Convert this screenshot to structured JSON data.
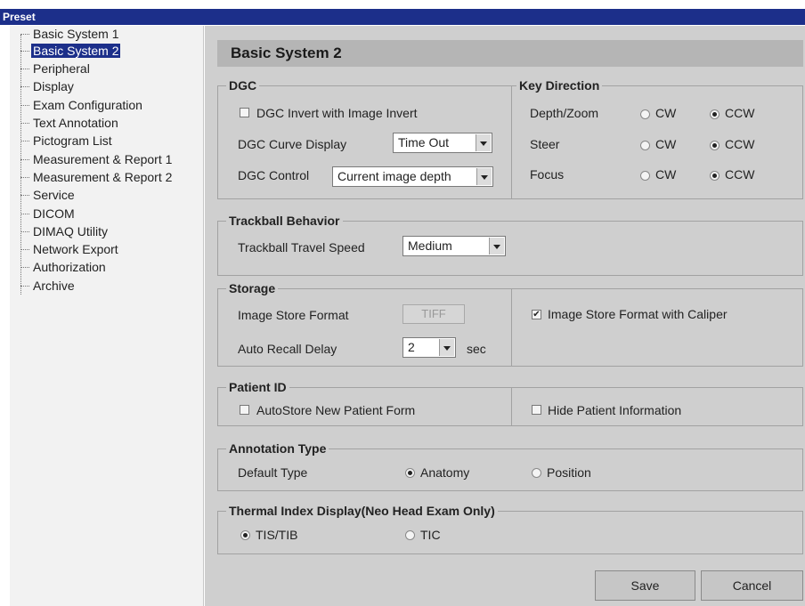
{
  "window": {
    "title": "Preset"
  },
  "sidebar": {
    "items": [
      {
        "label": "Basic System 1"
      },
      {
        "label": "Basic System 2",
        "selected": true
      },
      {
        "label": "Peripheral"
      },
      {
        "label": "Display"
      },
      {
        "label": "Exam Configuration"
      },
      {
        "label": "Text Annotation"
      },
      {
        "label": "Pictogram List"
      },
      {
        "label": "Measurement & Report 1"
      },
      {
        "label": "Measurement & Report 2"
      },
      {
        "label": "Service"
      },
      {
        "label": "DICOM"
      },
      {
        "label": "DIMAQ Utility"
      },
      {
        "label": "Network Export"
      },
      {
        "label": "Authorization"
      },
      {
        "label": "Archive"
      }
    ]
  },
  "page": {
    "title": "Basic System 2"
  },
  "dgc": {
    "title": "DGC",
    "invert_label": "DGC Invert with Image Invert",
    "invert_checked": false,
    "curve_display_label": "DGC Curve Display",
    "curve_display_value": "Time Out",
    "control_label": "DGC Control",
    "control_value": "Current image depth"
  },
  "key_direction": {
    "title": "Key Direction",
    "cw_label": "CW",
    "ccw_label": "CCW",
    "rows": [
      {
        "label": "Depth/Zoom",
        "selected": "CCW"
      },
      {
        "label": "Steer",
        "selected": "CCW"
      },
      {
        "label": "Focus",
        "selected": "CCW"
      }
    ]
  },
  "trackball": {
    "title": "Trackball Behavior",
    "speed_label": "Trackball Travel Speed",
    "speed_value": "Medium"
  },
  "storage": {
    "title": "Storage",
    "format_label": "Image Store Format",
    "format_value": "TIFF",
    "recall_label": "Auto Recall Delay",
    "recall_value": "2",
    "recall_unit": "sec",
    "caliper_label": "Image Store Format with Caliper",
    "caliper_checked": true
  },
  "patient_id": {
    "title": "Patient ID",
    "autostore_label": "AutoStore New Patient Form",
    "autostore_checked": false,
    "hide_label": "Hide Patient Information",
    "hide_checked": false
  },
  "annotation": {
    "title": "Annotation Type",
    "default_label": "Default Type",
    "anatomy_label": "Anatomy",
    "position_label": "Position",
    "selected": "Anatomy"
  },
  "thermal": {
    "title": "Thermal Index Display(Neo Head Exam Only)",
    "tis_label": "TIS/TIB",
    "tic_label": "TIC",
    "selected": "TIS/TIB"
  },
  "footer": {
    "save_label": "Save",
    "cancel_label": "Cancel"
  },
  "colors": {
    "title_bar": "#1c2f8a",
    "panel_bg": "#cfcfcf",
    "header_bg": "#b5b5b5",
    "selection": "#1c2f8a"
  }
}
